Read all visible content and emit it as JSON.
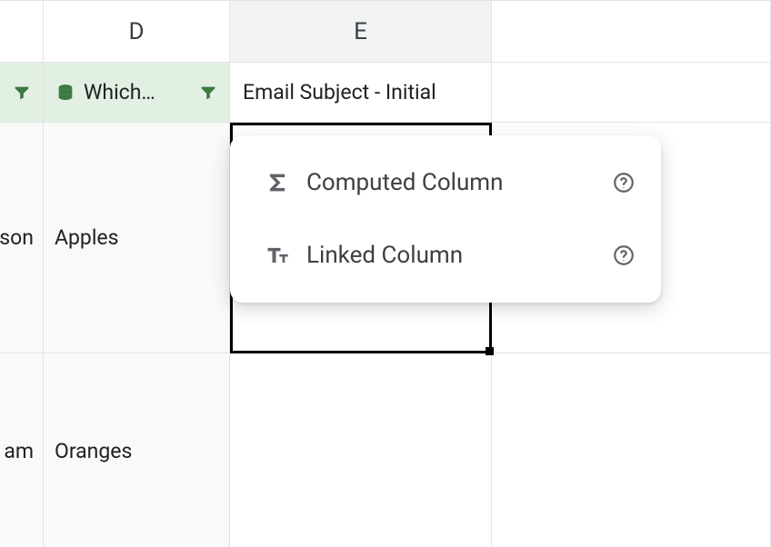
{
  "col_headers": {
    "d": "D",
    "e": "E"
  },
  "field_headers": {
    "d": "Which…",
    "e": "Email Subject - Initial"
  },
  "rows": [
    {
      "c": "son",
      "d": "Apples"
    },
    {
      "c": "am",
      "d": "Oranges"
    }
  ],
  "popup": {
    "items": [
      {
        "label": "Computed Column"
      },
      {
        "label": "Linked Column"
      }
    ]
  }
}
